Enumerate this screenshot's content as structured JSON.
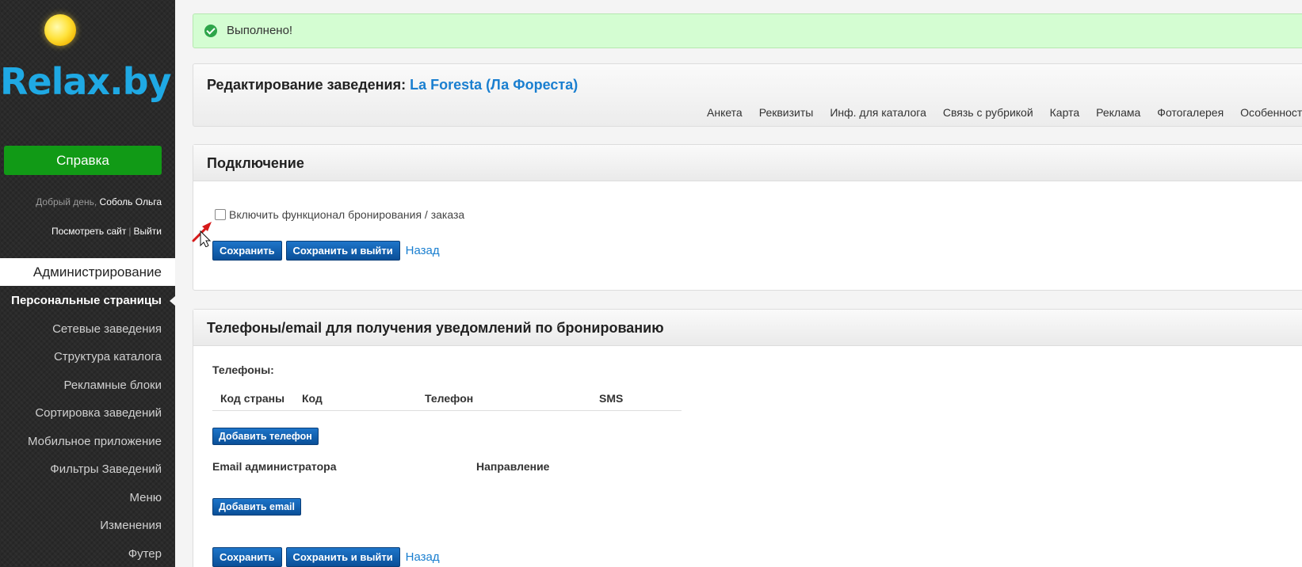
{
  "sidebar": {
    "logo_text": "Relax.by",
    "help_label": "Справка",
    "greeting_prefix": "Добрый день,",
    "user_name": "Соболь Ольга",
    "view_site": "Посмотреть сайт",
    "link_sep": "|",
    "logout": "Выйти",
    "admin_label": "Администрирование",
    "items": [
      {
        "label": "Персональные страницы"
      },
      {
        "label": "Сетевые заведения"
      },
      {
        "label": "Структура каталога"
      },
      {
        "label": "Рекламные блоки"
      },
      {
        "label": "Сортировка заведений"
      },
      {
        "label": "Мобильное приложение"
      },
      {
        "label": "Фильтры Заведений"
      },
      {
        "label": "Меню"
      },
      {
        "label": "Изменения"
      },
      {
        "label": "Футер"
      }
    ]
  },
  "alert": {
    "text": "Выполнено!"
  },
  "edit": {
    "title_prefix": "Редактирование заведения:",
    "venue_name": "La Foresta (Ла Фореста)",
    "tabs": [
      {
        "label": "Анкета"
      },
      {
        "label": "Реквизиты"
      },
      {
        "label": "Инф. для каталога"
      },
      {
        "label": "Связь с рубрикой"
      },
      {
        "label": "Карта"
      },
      {
        "label": "Реклама"
      },
      {
        "label": "Фотогалерея"
      },
      {
        "label": "Особенности"
      }
    ]
  },
  "connection": {
    "title": "Подключение",
    "checkbox_label": "Включить функционал бронирования / заказа",
    "save_label": "Сохранить",
    "save_exit_label": "Сохранить и выйти",
    "back_label": "Назад"
  },
  "notify": {
    "title": "Телефоны/email для получения уведомлений по бронированию",
    "phones_label": "Телефоны:",
    "columns": [
      "Код страны",
      "Код",
      "Телефон",
      "SMS"
    ],
    "add_phone_label": "Добавить телефон",
    "email_col": "Email администратора",
    "direction_col": "Направление",
    "add_email_label": "Добавить email",
    "save_label": "Сохранить",
    "save_exit_label": "Сохранить и выйти",
    "back_label": "Назад"
  },
  "colors": {
    "accent": "#1a7fd0",
    "help_green": "#119a16",
    "success_bg": "#d4fdd2",
    "logo": "#1fa9e4"
  }
}
